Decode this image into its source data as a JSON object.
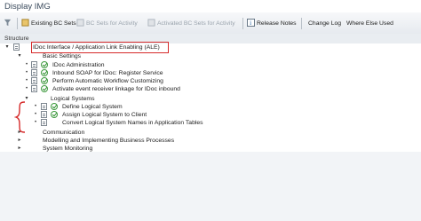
{
  "window": {
    "title": "Display IMG"
  },
  "toolbar": {
    "existing_bc_sets": "Existing BC Sets",
    "bc_sets_for_activity": "BC Sets for Activity",
    "activated_bc_sets": "Activated BC Sets for Activity",
    "release_notes": "Release Notes",
    "change_log": "Change Log",
    "where_else_used": "Where Else Used"
  },
  "structure": {
    "label": "Structure"
  },
  "tree": {
    "root": "IDoc Interface / Application Link Enabling (ALE)",
    "basic_settings": "Basic Settings",
    "basic_items": [
      "IDoc Administration",
      "Inbound SOAP for IDoc: Register Service",
      "Perform Automatic Workflow Customizing",
      "Activate event receiver linkage for IDoc inbound"
    ],
    "logical_systems": "Logical Systems",
    "logical_items": [
      "Define Logical System",
      "Assign Logical System to Client",
      "Convert Logical System Names in Application Tables"
    ],
    "other_nodes": [
      "Communication",
      "Modelling and Implementing Business Processes",
      "System Monitoring"
    ]
  },
  "colors": {
    "highlight": "#d62a2a",
    "check": "#2f8f2f"
  }
}
